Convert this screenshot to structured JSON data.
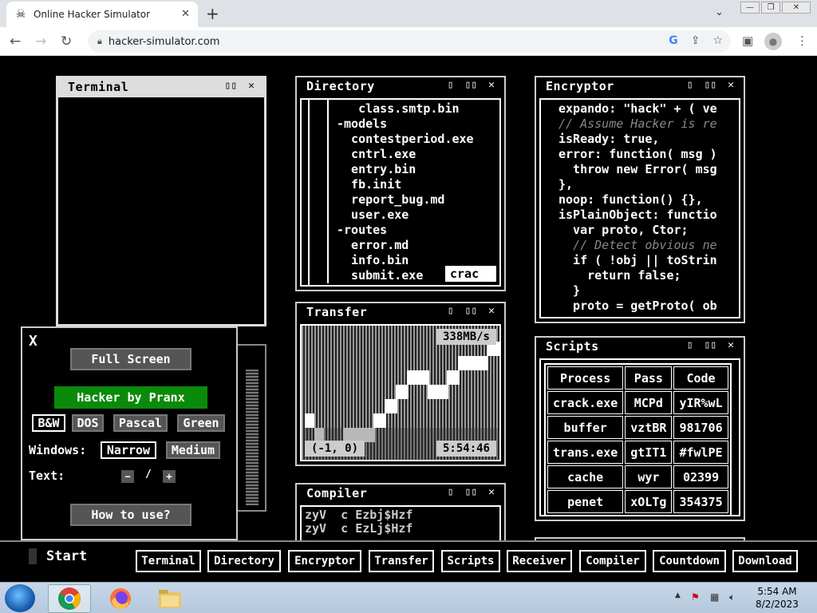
{
  "browser": {
    "tab_title": "Online Hacker Simulator",
    "url": "hacker-simulator.com"
  },
  "terminal": {
    "title": "Terminal"
  },
  "directory": {
    "title": "Directory",
    "lines": [
      "   class.smtp.bin",
      "-models",
      "  contestperiod.exe",
      "  cntrl.exe",
      "  entry.bin",
      "  fb.init",
      "  report_bug.md",
      "  user.exe",
      "-routes",
      "  error.md",
      "  info.bin",
      "  submit.exe"
    ],
    "highlight": "crac"
  },
  "encryptor": {
    "title": "Encryptor",
    "lines": [
      {
        "text": "expando: \"hack\" + ( ve",
        "dim": false
      },
      {
        "text": "// Assume Hacker is re",
        "dim": true
      },
      {
        "text": "isReady: true,",
        "dim": false
      },
      {
        "text": "error: function( msg )",
        "dim": false
      },
      {
        "text": "  throw new Error( msg",
        "dim": false
      },
      {
        "text": "},",
        "dim": false
      },
      {
        "text": "noop: function() {},",
        "dim": false
      },
      {
        "text": "isPlainObject: functio",
        "dim": false
      },
      {
        "text": "  var proto, Ctor;",
        "dim": false
      },
      {
        "text": "  // Detect obvious ne",
        "dim": true
      },
      {
        "text": "  if ( !obj || toStrin",
        "dim": false
      },
      {
        "text": "    return false;",
        "dim": false
      },
      {
        "text": "  }",
        "dim": false
      },
      {
        "text": "  proto = getProto( ob",
        "dim": false
      }
    ]
  },
  "transfer": {
    "title": "Transfer",
    "speed": "338MB/s",
    "coord": "(-1, 0)",
    "time": "5:54:46"
  },
  "scripts": {
    "title": "Scripts",
    "headers": [
      "Process",
      "Pass",
      "Code"
    ],
    "rows": [
      [
        "crack.exe",
        "MCPd",
        "yIR%wL"
      ],
      [
        "buffer",
        "vztBR",
        "981706"
      ],
      [
        "trans.exe",
        "gtIT1",
        "#fwlPE"
      ],
      [
        "cache",
        "wyr",
        "02399"
      ],
      [
        "penet",
        "xOLTg",
        "354375"
      ]
    ]
  },
  "compiler": {
    "title": "Compiler",
    "lines": [
      "zyV  c Ezbj$Hzf",
      "zyV  c EzLj$Hzf"
    ]
  },
  "settings": {
    "close": "X",
    "full_screen": "Full Screen",
    "by": "Hacker by Pranx",
    "themes": [
      "B&W",
      "DOS",
      "Pascal",
      "Green"
    ],
    "windows_label": "Windows:",
    "windows_opts": [
      "Narrow",
      "Medium"
    ],
    "text_label": "Text:",
    "text_minus": "−",
    "text_sep": "/",
    "text_plus": "+",
    "how_to": "How to use?"
  },
  "taskbar": {
    "start": "Start",
    "buttons": [
      "Terminal",
      "Directory",
      "Encryptor",
      "Transfer",
      "Scripts",
      "Receiver",
      "Compiler",
      "Countdown",
      "Download"
    ]
  },
  "os": {
    "time": "5:54 AM",
    "date": "8/2/2023"
  },
  "icons": {
    "favicon": "skull-icon",
    "window_max": "maximize-icon",
    "window_close": "close-icon"
  }
}
